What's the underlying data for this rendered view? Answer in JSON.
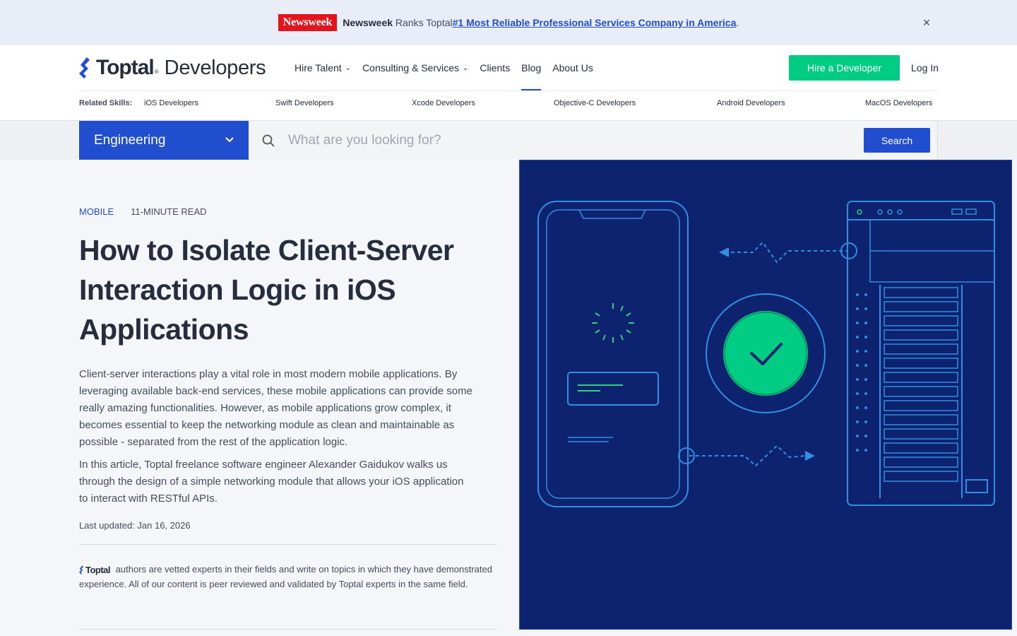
{
  "banner": {
    "brand": "Newsweek",
    "source": "Newsweek",
    "text": " Ranks Toptal ",
    "link": "#1 Most Reliable Professional Services Company in America",
    "suffix": ".",
    "close": "×"
  },
  "header": {
    "logo_word": "Toptal",
    "logo_reg": "®",
    "logo_suffix": "Developers",
    "nav": [
      {
        "label": "Hire Talent",
        "dropdown": true
      },
      {
        "label": "Consulting & Services",
        "dropdown": true
      },
      {
        "label": "Clients"
      },
      {
        "label": "Blog",
        "active": true
      },
      {
        "label": "About Us"
      }
    ],
    "hire_button": "Hire a Developer",
    "login": "Log In"
  },
  "related_skills": {
    "label": "Related Skills:",
    "items": [
      "iOS Developers",
      "Swift Developers",
      "Xcode Developers",
      "Objective-C Developers",
      "Android Developers",
      "MacOS Developers"
    ]
  },
  "search": {
    "category": "Engineering",
    "placeholder": "What are you looking for?",
    "button": "Search"
  },
  "article": {
    "category": "MOBILE",
    "read_time": "11-MINUTE READ",
    "title": "How to Isolate Client-Server Interaction Logic in iOS Applications",
    "paragraph1": "Client-server interactions play a vital role in most modern mobile applications. By leveraging available back-end services, these mobile applications can provide some really amazing functionalities. However, as mobile applications grow complex, it becomes essential to keep the networking module as clean and maintainable as possible - separated from the rest of the application logic.",
    "paragraph2": "In this article, Toptal freelance software engineer Alexander Gaidukov walks us through the design of a simple networking module that allows your iOS application to interact with RESTful APIs.",
    "updated": "Last updated: Jan 16, 2026",
    "vetted_logo": "Toptal",
    "vetted_text": "authors are vetted experts in their fields and write on topics in which they have demonstrated experience. All of our content is peer reviewed and validated by Toptal experts in the same field."
  },
  "colors": {
    "accent_blue": "#204ecf",
    "accent_green": "#00cc83",
    "hero_bg": "#0e2370",
    "newsweek_red": "#e3141b"
  }
}
